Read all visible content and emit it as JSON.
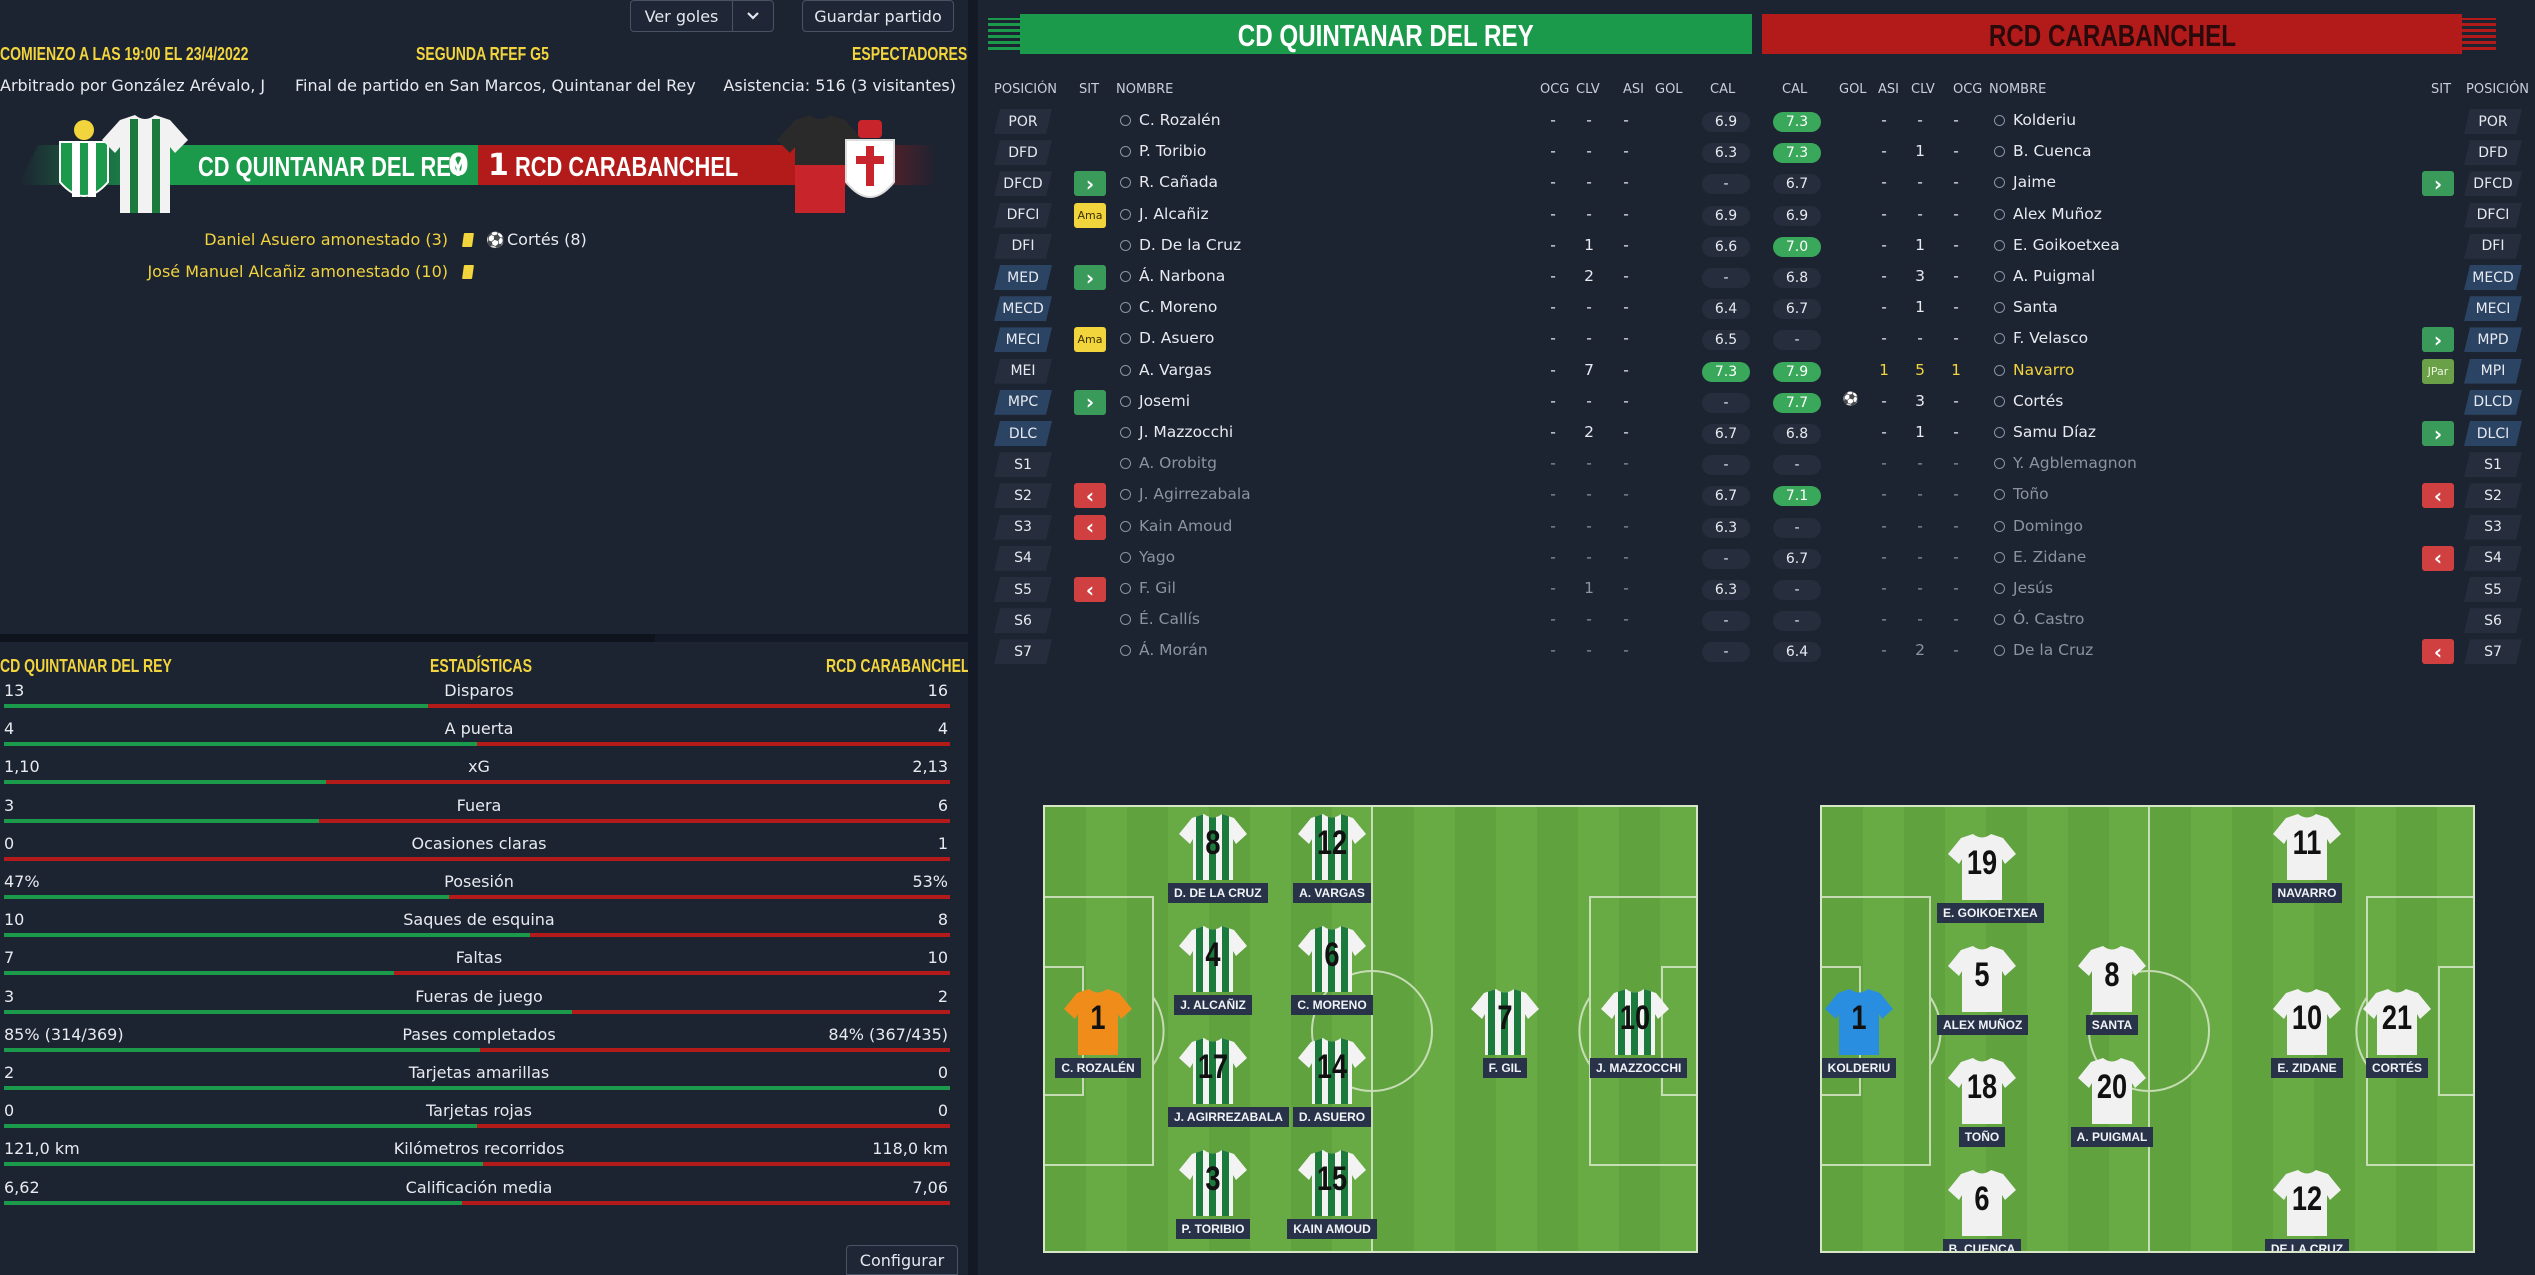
{
  "header": {
    "kickoff": "COMIENZO A LAS 19:00 EL 23/4/2022",
    "competition": "SEGUNDA RFEF G5",
    "spectators_label": "ESPECTADORES",
    "referee": "Arbitrado por González Arévalo, J",
    "final": "Final de partido en San Marcos, Quintanar del Rey",
    "attendance": "Asistencia: 516 (3 visitantes)",
    "btn_goals": "Ver goles",
    "btn_save": "Guardar partido"
  },
  "score": {
    "home": "CD QUINTANAR DEL REY",
    "home_goals": "0",
    "away_goals": "1",
    "away": "RCD CARABANCHEL"
  },
  "events": [
    {
      "text": "Daniel Asuero amonestado (3)",
      "right": "Cortés (8)"
    },
    {
      "text": "José Manuel Alcañiz amonestado (10)",
      "right": ""
    }
  ],
  "stats": {
    "home": "CD QUINTANAR DEL REY",
    "title": "ESTADÍSTICAS",
    "away": "RCD CARABANCHEL",
    "rows": [
      {
        "l": "13",
        "label": "Disparos",
        "r": "16",
        "share": 0.448
      },
      {
        "l": "4",
        "label": "A puerta",
        "r": "4",
        "share": 0.5
      },
      {
        "l": "1,10",
        "label": "xG",
        "r": "2,13",
        "share": 0.34
      },
      {
        "l": "3",
        "label": "Fuera",
        "r": "6",
        "share": 0.333
      },
      {
        "l": "0",
        "label": "Ocasiones claras",
        "r": "1",
        "share": 0.0
      },
      {
        "l": "47%",
        "label": "Posesión",
        "r": "53%",
        "share": 0.47
      },
      {
        "l": "10",
        "label": "Saques de esquina",
        "r": "8",
        "share": 0.556
      },
      {
        "l": "7",
        "label": "Faltas",
        "r": "10",
        "share": 0.412
      },
      {
        "l": "3",
        "label": "Fueras de juego",
        "r": "2",
        "share": 0.6
      },
      {
        "l": "85% (314/369)",
        "label": "Pases completados",
        "r": "84% (367/435)",
        "share": 0.503
      },
      {
        "l": "2",
        "label": "Tarjetas amarillas",
        "r": "0",
        "share": 1.0
      },
      {
        "l": "0",
        "label": "Tarjetas rojas",
        "r": "0",
        "share": 0.5
      },
      {
        "l": "121,0 km",
        "label": "Kilómetros recorridos",
        "r": "118,0 km",
        "share": 0.506
      },
      {
        "l": "6,62",
        "label": "Calificación media",
        "r": "7,06",
        "share": 0.484
      }
    ],
    "configure": "Configurar"
  },
  "lineups": {
    "home_title": "CD QUINTANAR DEL REY",
    "away_title": "RCD CARABANCHEL",
    "headers": {
      "pos": "POSICIÓN",
      "sit": "SIT",
      "name": "NOMBRE",
      "ocg": "OCG",
      "clv": "CLV",
      "asi": "ASI",
      "gol": "GOL",
      "cal": "CAL"
    },
    "rows": [
      {
        "hp": "POR",
        "hs": "",
        "hn": "C. Rozalén",
        "ho": "-",
        "hc": "-",
        "ha": "-",
        "hcal": "6.9",
        "acal": "7.3",
        "ag": "",
        "aa": "-",
        "ac": "-",
        "ao": "-",
        "an": "Kolderiu",
        "as": "",
        "ap": "POR",
        "hcg": 0,
        "acg": 1,
        "dim": 0
      },
      {
        "hp": "DFD",
        "hs": "",
        "hn": "P. Toribio",
        "ho": "-",
        "hc": "-",
        "ha": "-",
        "hcal": "6.3",
        "acal": "7.3",
        "ag": "",
        "aa": "-",
        "ac": "1",
        "ao": "-",
        "an": "B. Cuenca",
        "as": "",
        "ap": "DFD",
        "hcg": 0,
        "acg": 1,
        "dim": 0
      },
      {
        "hp": "DFCD",
        "hs": "in",
        "hn": "R. Cañada",
        "ho": "-",
        "hc": "-",
        "ha": "-",
        "hcal": "-",
        "acal": "6.7",
        "ag": "",
        "aa": "-",
        "ac": "-",
        "ao": "-",
        "an": "Jaime",
        "as": "in",
        "ap": "DFCD",
        "hcg": 0,
        "acg": 0,
        "dim": 0
      },
      {
        "hp": "DFCI",
        "hs": "Ama",
        "hn": "J. Alcañiz",
        "ho": "-",
        "hc": "-",
        "ha": "-",
        "hcal": "6.9",
        "acal": "6.9",
        "ag": "",
        "aa": "-",
        "ac": "-",
        "ao": "-",
        "an": "Alex Muñoz",
        "as": "",
        "ap": "DFCI",
        "hcg": 0,
        "acg": 0,
        "dim": 0
      },
      {
        "hp": "DFI",
        "hs": "",
        "hn": "D. De la Cruz",
        "ho": "-",
        "hc": "1",
        "ha": "-",
        "hcal": "6.6",
        "acal": "7.0",
        "ag": "",
        "aa": "-",
        "ac": "1",
        "ao": "-",
        "an": "E. Goikoetxea",
        "as": "",
        "ap": "DFI",
        "hcg": 0,
        "acg": 1,
        "dim": 0
      },
      {
        "hp": "MED",
        "hs": "in",
        "hn": "Á. Narbona",
        "ho": "-",
        "hc": "2",
        "ha": "-",
        "hcal": "-",
        "acal": "6.8",
        "ag": "",
        "aa": "-",
        "ac": "3",
        "ao": "-",
        "an": "A. Puigmal",
        "as": "",
        "ap": "MECD",
        "hcg": 0,
        "acg": 0,
        "dim": 0
      },
      {
        "hp": "MECD",
        "hs": "",
        "hn": "C. Moreno",
        "ho": "-",
        "hc": "-",
        "ha": "-",
        "hcal": "6.4",
        "acal": "6.7",
        "ag": "",
        "aa": "-",
        "ac": "1",
        "ao": "-",
        "an": "Santa",
        "as": "",
        "ap": "MECI",
        "hcg": 0,
        "acg": 0,
        "dim": 0
      },
      {
        "hp": "MECI",
        "hs": "Ama",
        "hn": "D. Asuero",
        "ho": "-",
        "hc": "-",
        "ha": "-",
        "hcal": "6.5",
        "acal": "-",
        "ag": "",
        "aa": "-",
        "ac": "-",
        "ao": "-",
        "an": "F. Velasco",
        "as": "in",
        "ap": "MPD",
        "hcg": 0,
        "acg": 0,
        "dim": 0
      },
      {
        "hp": "MEI",
        "hs": "",
        "hn": "A. Vargas",
        "ho": "-",
        "hc": "7",
        "ha": "-",
        "hcal": "7.3",
        "acal": "7.9",
        "ag": "",
        "aa": "1",
        "ac": "5",
        "ao": "1",
        "an": "Navarro",
        "as": "JPar",
        "ap": "MPI",
        "hcg": 1,
        "acg": 1,
        "dim": 0,
        "ahl": 1
      },
      {
        "hp": "MPC",
        "hs": "in",
        "hn": "Josemi",
        "ho": "-",
        "hc": "-",
        "ha": "-",
        "hcal": "-",
        "acal": "7.7",
        "ag": "ball",
        "aa": "-",
        "ac": "3",
        "ao": "-",
        "an": "Cortés",
        "as": "",
        "ap": "DLCD",
        "hcg": 0,
        "acg": 1,
        "dim": 0
      },
      {
        "hp": "DLC",
        "hs": "",
        "hn": "J. Mazzocchi",
        "ho": "-",
        "hc": "2",
        "ha": "-",
        "hcal": "6.7",
        "acal": "6.8",
        "ag": "",
        "aa": "-",
        "ac": "1",
        "ao": "-",
        "an": "Samu Díaz",
        "as": "in",
        "ap": "DLCI",
        "hcg": 0,
        "acg": 0,
        "dim": 0
      },
      {
        "hp": "S1",
        "hs": "",
        "hn": "A. Orobitg",
        "ho": "-",
        "hc": "-",
        "ha": "-",
        "hcal": "-",
        "acal": "-",
        "ag": "",
        "aa": "-",
        "ac": "-",
        "ao": "-",
        "an": "Y. Agblemagnon",
        "as": "",
        "ap": "S1",
        "hcg": 0,
        "acg": 0,
        "dim": 1
      },
      {
        "hp": "S2",
        "hs": "out",
        "hn": "J. Agirrezabala",
        "ho": "-",
        "hc": "-",
        "ha": "-",
        "hcal": "6.7",
        "acal": "7.1",
        "ag": "",
        "aa": "-",
        "ac": "-",
        "ao": "-",
        "an": "Toño",
        "as": "out",
        "ap": "S2",
        "hcg": 0,
        "acg": 1,
        "dim": 1
      },
      {
        "hp": "S3",
        "hs": "out",
        "hn": "Kain Amoud",
        "ho": "-",
        "hc": "-",
        "ha": "-",
        "hcal": "6.3",
        "acal": "-",
        "ag": "",
        "aa": "-",
        "ac": "-",
        "ao": "-",
        "an": "Domingo",
        "as": "",
        "ap": "S3",
        "hcg": 0,
        "acg": 0,
        "dim": 1
      },
      {
        "hp": "S4",
        "hs": "",
        "hn": "Yago",
        "ho": "-",
        "hc": "-",
        "ha": "-",
        "hcal": "-",
        "acal": "6.7",
        "ag": "",
        "aa": "-",
        "ac": "-",
        "ao": "-",
        "an": "E. Zidane",
        "as": "out",
        "ap": "S4",
        "hcg": 0,
        "acg": 0,
        "dim": 1
      },
      {
        "hp": "S5",
        "hs": "out",
        "hn": "F. Gil",
        "ho": "-",
        "hc": "1",
        "ha": "-",
        "hcal": "6.3",
        "acal": "-",
        "ag": "",
        "aa": "-",
        "ac": "-",
        "ao": "-",
        "an": "Jesús",
        "as": "",
        "ap": "S5",
        "hcg": 0,
        "acg": 0,
        "dim": 1
      },
      {
        "hp": "S6",
        "hs": "",
        "hn": "É. Callís",
        "ho": "-",
        "hc": "-",
        "ha": "-",
        "hcal": "-",
        "acal": "-",
        "ag": "",
        "aa": "-",
        "ac": "-",
        "ao": "-",
        "an": "Ó. Castro",
        "as": "",
        "ap": "S6",
        "hcg": 0,
        "acg": 0,
        "dim": 1
      },
      {
        "hp": "S7",
        "hs": "",
        "hn": "Á. Morán",
        "ho": "-",
        "hc": "-",
        "ha": "-",
        "hcal": "-",
        "acal": "6.4",
        "ag": "",
        "aa": "-",
        "ac": "2",
        "ao": "-",
        "an": "De la Cruz",
        "as": "out",
        "ap": "S7",
        "hcg": 0,
        "acg": 0,
        "dim": 1
      }
    ]
  },
  "pitch_home": [
    {
      "n": "1",
      "name": "C. ROZALÉN",
      "gk": 1
    },
    {
      "n": "8",
      "name": "D. DE LA CRUZ"
    },
    {
      "n": "12",
      "name": "A. VARGAS"
    },
    {
      "n": "4",
      "name": "J. ALCAÑIZ"
    },
    {
      "n": "6",
      "name": "C. MORENO"
    },
    {
      "n": "17",
      "name": "J. AGIRREZABALA"
    },
    {
      "n": "14",
      "name": "D. ASUERO"
    },
    {
      "n": "3",
      "name": "P. TORIBIO"
    },
    {
      "n": "15",
      "name": "KAIN AMOUD"
    },
    {
      "n": "7",
      "name": "F. GIL"
    },
    {
      "n": "10",
      "name": "J. MAZZOCCHI"
    }
  ],
  "pitch_away": [
    {
      "n": "1",
      "name": "KOLDERIU",
      "gk": 1
    },
    {
      "n": "19",
      "name": "E. GOIKOETXEA"
    },
    {
      "n": "11",
      "name": "NAVARRO"
    },
    {
      "n": "5",
      "name": "ALEX MUÑOZ"
    },
    {
      "n": "8",
      "name": "SANTA"
    },
    {
      "n": "10",
      "name": "E. ZIDANE"
    },
    {
      "n": "21",
      "name": "CORTÉS"
    },
    {
      "n": "18",
      "name": "TOÑO"
    },
    {
      "n": "20",
      "name": "A. PUIGMAL"
    },
    {
      "n": "6",
      "name": "B. CUENCA"
    },
    {
      "n": "12",
      "name": "DE LA CRUZ"
    }
  ],
  "colors": {
    "home_green": "#1c9a4c",
    "away_red": "#b31b1b",
    "accent_yellow": "#f2d43d",
    "sub_in": "#3a9a5a",
    "sub_out": "#d14040"
  },
  "icons": [
    "player-icon",
    "ball-icon",
    "yellow-card-icon",
    "chevron-down-icon",
    "sub-in-icon",
    "sub-out-icon"
  ]
}
